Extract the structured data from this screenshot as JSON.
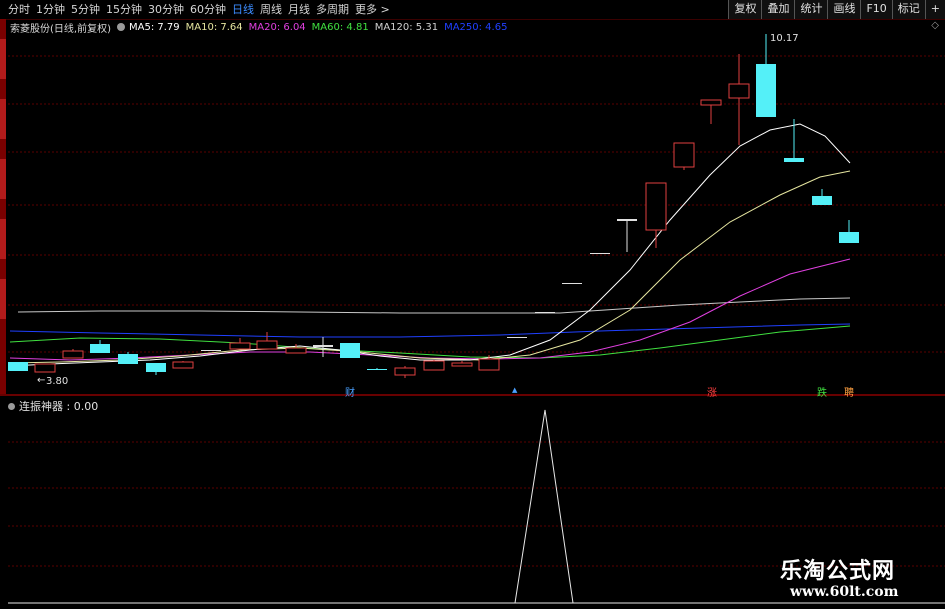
{
  "toolbar": {
    "tabs": [
      "分时",
      "1分钟",
      "5分钟",
      "15分钟",
      "30分钟",
      "60分钟",
      "日线",
      "周线",
      "月线",
      "多周期",
      "更多 >"
    ],
    "active_tab": "日线",
    "right_buttons": [
      "复权",
      "叠加",
      "统计",
      "画线",
      "F10",
      "标记",
      "+"
    ]
  },
  "legend": {
    "stock": "索菱股份(日线,前复权)",
    "ma": [
      {
        "label": "MA5: 7.79",
        "color": "#ffffff"
      },
      {
        "label": "MA10: 7.64",
        "color": "#e6e6a0"
      },
      {
        "label": "MA20: 6.04",
        "color": "#e040e0"
      },
      {
        "label": "MA60: 4.81",
        "color": "#40e040"
      },
      {
        "label": "MA120: 5.31",
        "color": "#d0d0d0"
      },
      {
        "label": "MA250: 4.65",
        "color": "#2040ff"
      }
    ]
  },
  "price_labels": {
    "high": "10.17",
    "low": "3.80"
  },
  "markers": [
    {
      "text": "财",
      "color": "#4aa0ff"
    },
    {
      "text": "▲",
      "color": "#4aa0ff"
    },
    {
      "text": "涨",
      "color": "#ff4040"
    },
    {
      "text": "跌",
      "color": "#40e040"
    },
    {
      "text": "聘",
      "color": "#ffa040"
    }
  ],
  "indicator": {
    "title": "连振神器 : 0.00"
  },
  "watermark": {
    "line1": "乐淘公式网",
    "line2": "www.60lt.com"
  },
  "colors": {
    "up": "#e04040",
    "down": "#54f0f8",
    "grid": "#5a0000",
    "background": "#000000"
  }
}
